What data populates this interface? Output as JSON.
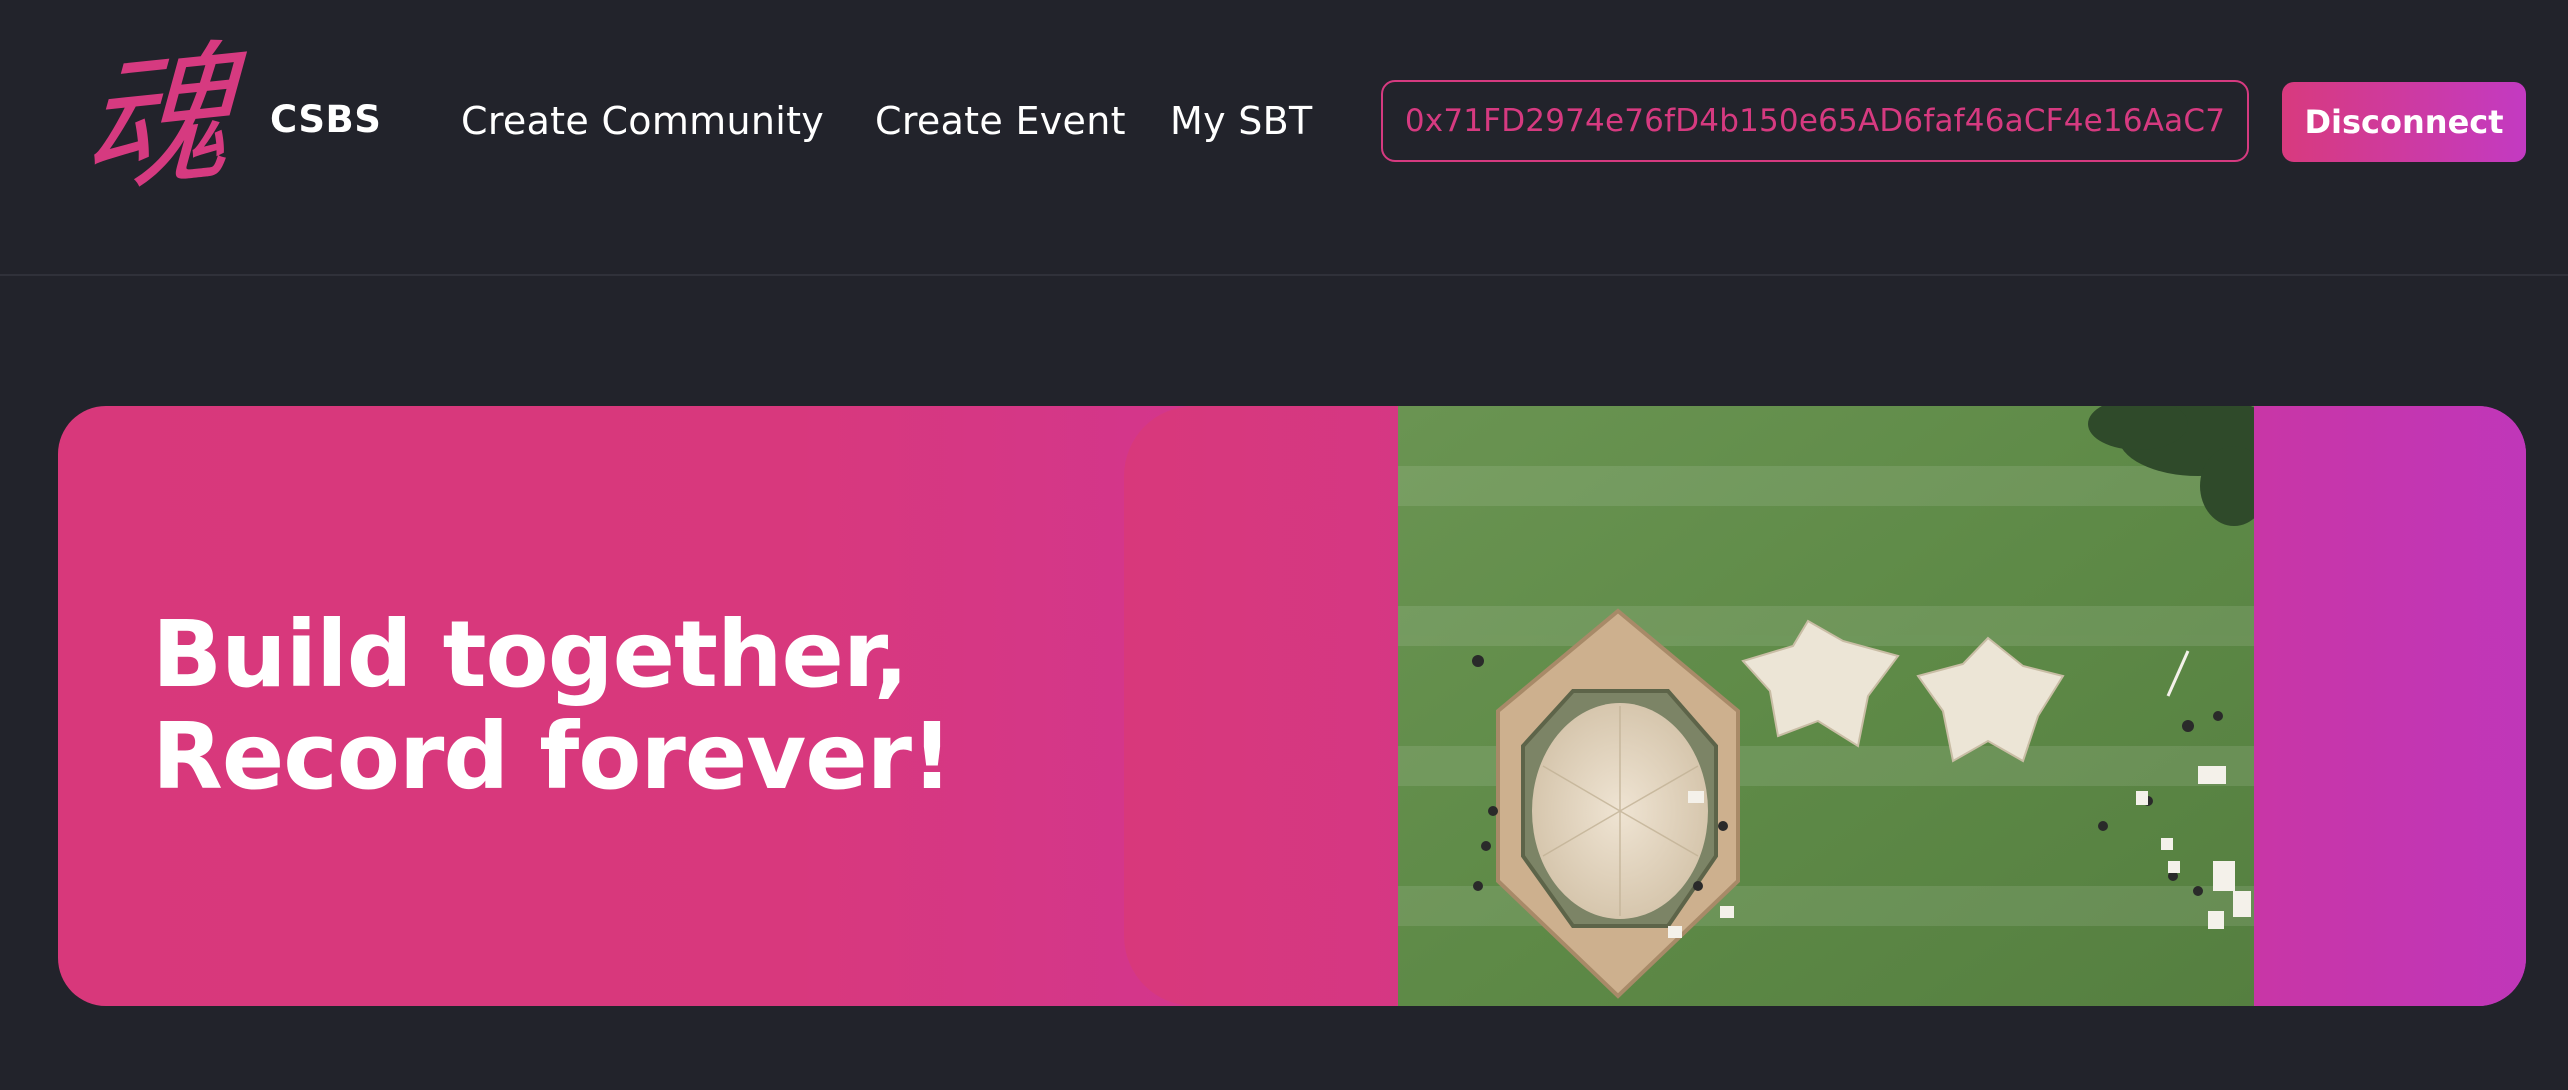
{
  "header": {
    "logo_char": "魂",
    "brand": "CSBS",
    "nav": [
      {
        "label": "Create Community"
      },
      {
        "label": "Create Event"
      },
      {
        "label": "My SBT"
      }
    ],
    "wallet_address": "0x71FD2974e76fD4b150e65AD6faf46aCF4e16AaC7",
    "disconnect_label": "Disconnect"
  },
  "hero": {
    "headline_line1": "Build together,",
    "headline_line2": "Record forever!",
    "image_subject": "aerial view of tents on a grass field"
  },
  "colors": {
    "background": "#22232b",
    "accent_pink": "#d63a80",
    "accent_purple": "#bb36c2",
    "text": "#ffffff",
    "grass": "#5f8a45"
  }
}
